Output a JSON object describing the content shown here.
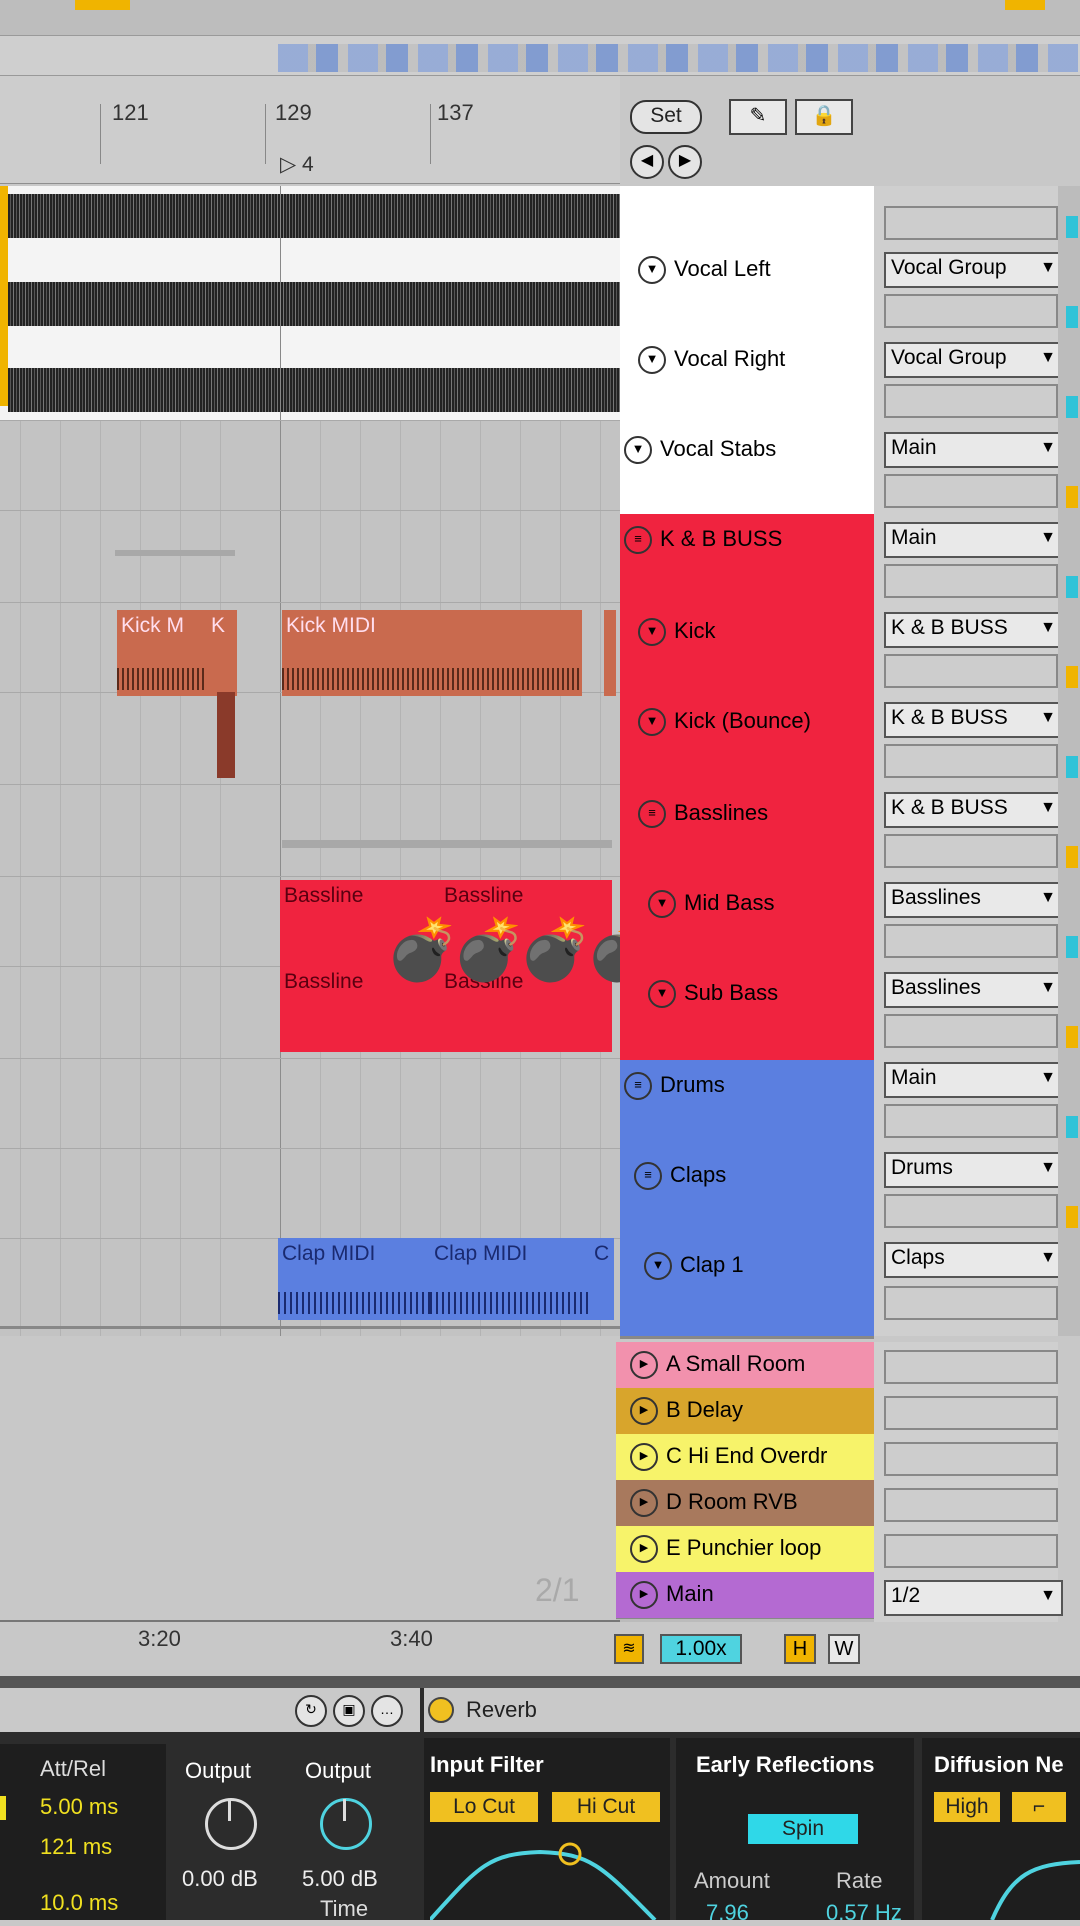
{
  "ruler": {
    "bars": [
      "121",
      "129",
      "137"
    ],
    "loop_marker": "4",
    "set_label": "Set",
    "draw_icon": "pencil-icon",
    "lock_icon": "lock-icon"
  },
  "tracks": [
    {
      "name": "Vocal  Left",
      "route": "Vocal Group"
    },
    {
      "name": "Vocal Right",
      "route": "Vocal Group"
    },
    {
      "name": "Vocal Stabs",
      "route": "Main"
    },
    {
      "name": "K & B BUSS",
      "route": "Main"
    },
    {
      "name": "Kick",
      "route": "K & B BUSS"
    },
    {
      "name": "Kick (Bounce)",
      "route": "K & B BUSS"
    },
    {
      "name": "Basslines",
      "route": "K & B BUSS"
    },
    {
      "name": "Mid Bass",
      "route": "Basslines"
    },
    {
      "name": "Sub Bass",
      "route": "Basslines"
    },
    {
      "name": "Drums",
      "route": "Main"
    },
    {
      "name": "Claps",
      "route": "Drums"
    },
    {
      "name": "Clap 1",
      "route": "Claps"
    }
  ],
  "returns": [
    {
      "name": "A Small Room"
    },
    {
      "name": "B Delay"
    },
    {
      "name": "C Hi End Overdr"
    },
    {
      "name": "D Room RVB"
    },
    {
      "name": "E Punchier loop"
    },
    {
      "name": "Main",
      "route": "1/2"
    }
  ],
  "clips": {
    "kick_a": "Kick M",
    "kick_b": "K",
    "kick_midi": "Kick MIDI",
    "bassline1": "Bassline",
    "bassline2": "Bassline",
    "bassline3": "Bassline",
    "bassline4": "Bassline",
    "clap1": "Clap MIDI",
    "clap2": "Clap MIDI",
    "clap3": "C"
  },
  "overlay": "💣💣💣💣",
  "timeline": {
    "t1": "3:20",
    "t2": "3:40",
    "page": "2/1",
    "zoom": "1.00x",
    "h": "H",
    "w": "W"
  },
  "device": {
    "name": "Reverb",
    "att_rel_label": "Att/Rel",
    "att": "5.00 ms",
    "rel": "121 ms",
    "third": "10.0 ms",
    "output1_label": "Output",
    "output1_value": "0.00 dB",
    "output2_label": "Output",
    "output2_value": "5.00 dB",
    "time_label": "Time",
    "input_filter_label": "Input Filter",
    "lo_cut": "Lo Cut",
    "hi_cut": "Hi Cut",
    "early_reflections_label": "Early Reflections",
    "spin": "Spin",
    "amount_label": "Amount",
    "amount_value": "7.96",
    "rate_label": "Rate",
    "rate_value": "0.57 Hz",
    "diffusion_label": "Diffusion Ne",
    "high": "High"
  },
  "colors": {
    "red": "#f0233f",
    "blue": "#5b7fe0",
    "kick_clip": "#c96a4e",
    "pink": "#f291ad",
    "gold": "#d8a52c",
    "yellow": "#f7f36a",
    "brown": "#a8795d",
    "purple": "#b46ad2"
  }
}
